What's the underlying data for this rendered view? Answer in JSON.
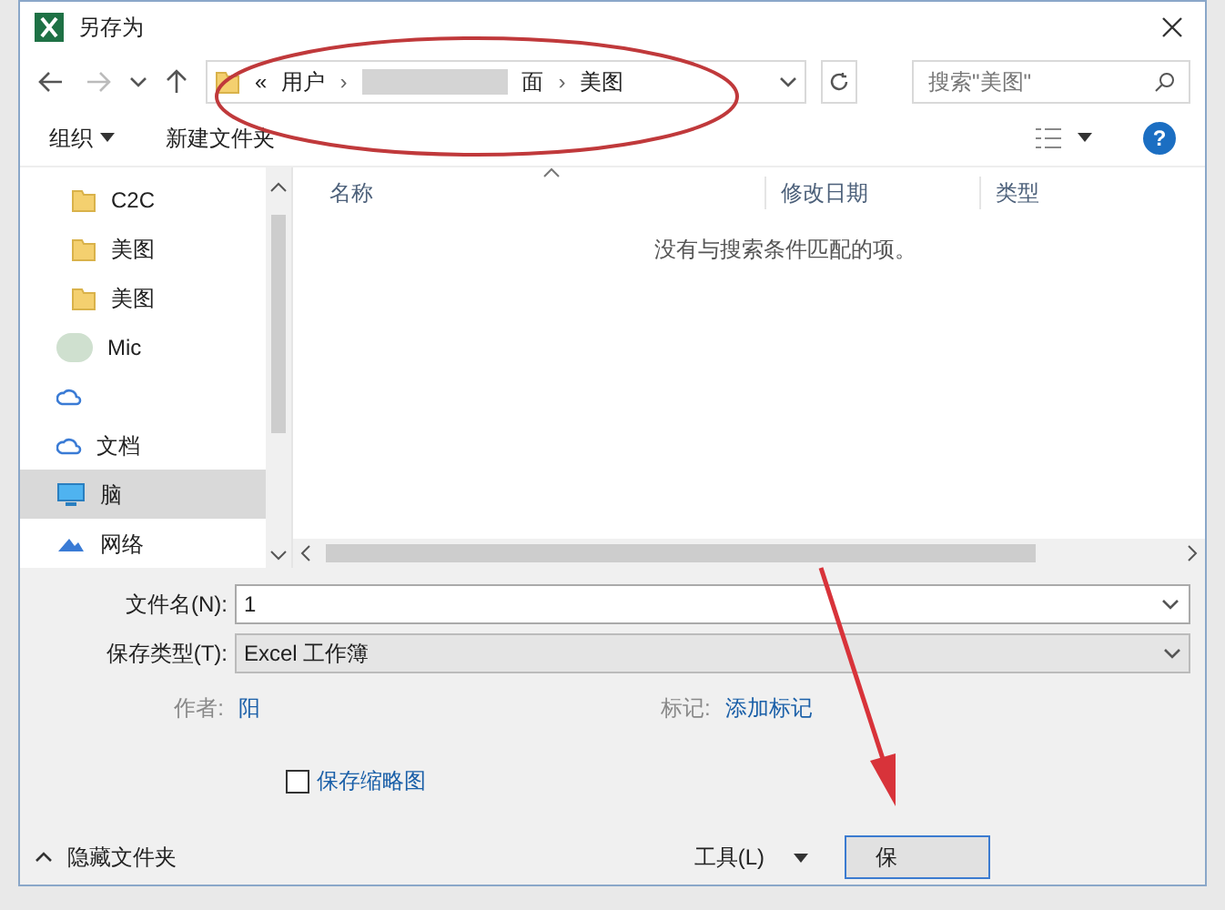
{
  "window": {
    "title": "另存为"
  },
  "address": {
    "prefix": "«",
    "crumbs": [
      "用户",
      "面",
      "美图"
    ],
    "separator": "›"
  },
  "search": {
    "placeholder": "搜索\"美图\""
  },
  "toolbar": {
    "organize": "组织",
    "new_folder": "新建文件夹",
    "help": "?"
  },
  "sidebar": {
    "items": [
      {
        "label": "C2C",
        "kind": "folder",
        "selected": false
      },
      {
        "label": "美图",
        "kind": "folder",
        "selected": false
      },
      {
        "label": "美图",
        "kind": "folder",
        "selected": false
      },
      {
        "label": "Mic",
        "kind": "blank",
        "selected": false
      },
      {
        "kind": "cloud",
        "selected": false
      },
      {
        "label": "文档",
        "kind": "cloud",
        "selected": false
      },
      {
        "label": "脑",
        "kind": "pc",
        "selected": true
      },
      {
        "label": "网络",
        "kind": "network",
        "selected": false
      }
    ]
  },
  "table": {
    "columns": [
      "名称",
      "修改日期",
      "类型"
    ],
    "empty_message": "没有与搜索条件匹配的项。"
  },
  "form": {
    "filename_label": "文件名(N):",
    "filename": "1",
    "type_label": "保存类型(T):",
    "type": "Excel 工作簿",
    "author_label": "作者:",
    "author": "阳",
    "tags_label": "标记:",
    "tags": "添加标记",
    "thumbnail": {
      "label": "保存缩略图",
      "checked": false
    }
  },
  "footer": {
    "hide_folders": "隐藏文件夹",
    "tools": "工具(L)",
    "save": "保"
  }
}
